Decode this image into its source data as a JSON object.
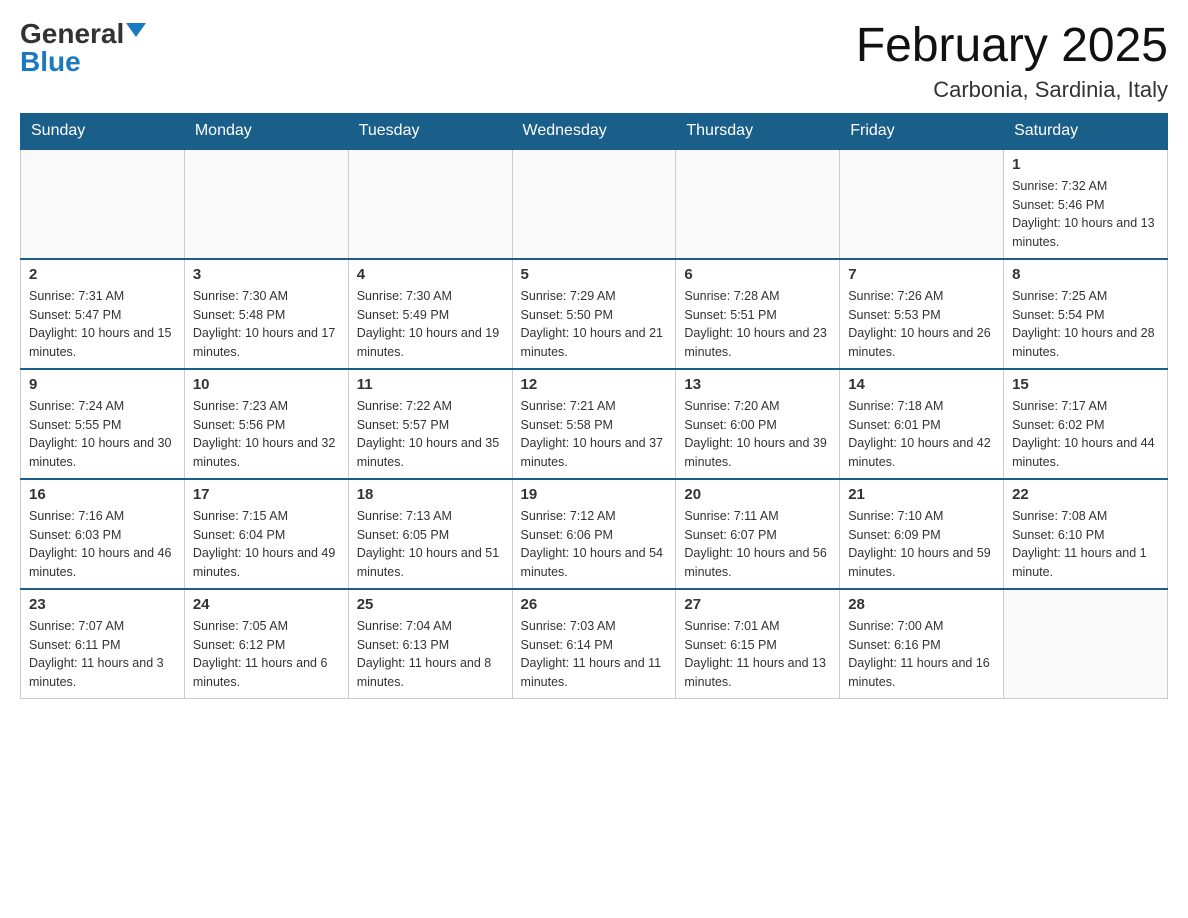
{
  "logo": {
    "general": "General",
    "blue": "Blue"
  },
  "title": "February 2025",
  "subtitle": "Carbonia, Sardinia, Italy",
  "days_of_week": [
    "Sunday",
    "Monday",
    "Tuesday",
    "Wednesday",
    "Thursday",
    "Friday",
    "Saturday"
  ],
  "weeks": [
    [
      null,
      null,
      null,
      null,
      null,
      null,
      {
        "day": "1",
        "sunrise": "Sunrise: 7:32 AM",
        "sunset": "Sunset: 5:46 PM",
        "daylight": "Daylight: 10 hours and 13 minutes."
      }
    ],
    [
      {
        "day": "2",
        "sunrise": "Sunrise: 7:31 AM",
        "sunset": "Sunset: 5:47 PM",
        "daylight": "Daylight: 10 hours and 15 minutes."
      },
      {
        "day": "3",
        "sunrise": "Sunrise: 7:30 AM",
        "sunset": "Sunset: 5:48 PM",
        "daylight": "Daylight: 10 hours and 17 minutes."
      },
      {
        "day": "4",
        "sunrise": "Sunrise: 7:30 AM",
        "sunset": "Sunset: 5:49 PM",
        "daylight": "Daylight: 10 hours and 19 minutes."
      },
      {
        "day": "5",
        "sunrise": "Sunrise: 7:29 AM",
        "sunset": "Sunset: 5:50 PM",
        "daylight": "Daylight: 10 hours and 21 minutes."
      },
      {
        "day": "6",
        "sunrise": "Sunrise: 7:28 AM",
        "sunset": "Sunset: 5:51 PM",
        "daylight": "Daylight: 10 hours and 23 minutes."
      },
      {
        "day": "7",
        "sunrise": "Sunrise: 7:26 AM",
        "sunset": "Sunset: 5:53 PM",
        "daylight": "Daylight: 10 hours and 26 minutes."
      },
      {
        "day": "8",
        "sunrise": "Sunrise: 7:25 AM",
        "sunset": "Sunset: 5:54 PM",
        "daylight": "Daylight: 10 hours and 28 minutes."
      }
    ],
    [
      {
        "day": "9",
        "sunrise": "Sunrise: 7:24 AM",
        "sunset": "Sunset: 5:55 PM",
        "daylight": "Daylight: 10 hours and 30 minutes."
      },
      {
        "day": "10",
        "sunrise": "Sunrise: 7:23 AM",
        "sunset": "Sunset: 5:56 PM",
        "daylight": "Daylight: 10 hours and 32 minutes."
      },
      {
        "day": "11",
        "sunrise": "Sunrise: 7:22 AM",
        "sunset": "Sunset: 5:57 PM",
        "daylight": "Daylight: 10 hours and 35 minutes."
      },
      {
        "day": "12",
        "sunrise": "Sunrise: 7:21 AM",
        "sunset": "Sunset: 5:58 PM",
        "daylight": "Daylight: 10 hours and 37 minutes."
      },
      {
        "day": "13",
        "sunrise": "Sunrise: 7:20 AM",
        "sunset": "Sunset: 6:00 PM",
        "daylight": "Daylight: 10 hours and 39 minutes."
      },
      {
        "day": "14",
        "sunrise": "Sunrise: 7:18 AM",
        "sunset": "Sunset: 6:01 PM",
        "daylight": "Daylight: 10 hours and 42 minutes."
      },
      {
        "day": "15",
        "sunrise": "Sunrise: 7:17 AM",
        "sunset": "Sunset: 6:02 PM",
        "daylight": "Daylight: 10 hours and 44 minutes."
      }
    ],
    [
      {
        "day": "16",
        "sunrise": "Sunrise: 7:16 AM",
        "sunset": "Sunset: 6:03 PM",
        "daylight": "Daylight: 10 hours and 46 minutes."
      },
      {
        "day": "17",
        "sunrise": "Sunrise: 7:15 AM",
        "sunset": "Sunset: 6:04 PM",
        "daylight": "Daylight: 10 hours and 49 minutes."
      },
      {
        "day": "18",
        "sunrise": "Sunrise: 7:13 AM",
        "sunset": "Sunset: 6:05 PM",
        "daylight": "Daylight: 10 hours and 51 minutes."
      },
      {
        "day": "19",
        "sunrise": "Sunrise: 7:12 AM",
        "sunset": "Sunset: 6:06 PM",
        "daylight": "Daylight: 10 hours and 54 minutes."
      },
      {
        "day": "20",
        "sunrise": "Sunrise: 7:11 AM",
        "sunset": "Sunset: 6:07 PM",
        "daylight": "Daylight: 10 hours and 56 minutes."
      },
      {
        "day": "21",
        "sunrise": "Sunrise: 7:10 AM",
        "sunset": "Sunset: 6:09 PM",
        "daylight": "Daylight: 10 hours and 59 minutes."
      },
      {
        "day": "22",
        "sunrise": "Sunrise: 7:08 AM",
        "sunset": "Sunset: 6:10 PM",
        "daylight": "Daylight: 11 hours and 1 minute."
      }
    ],
    [
      {
        "day": "23",
        "sunrise": "Sunrise: 7:07 AM",
        "sunset": "Sunset: 6:11 PM",
        "daylight": "Daylight: 11 hours and 3 minutes."
      },
      {
        "day": "24",
        "sunrise": "Sunrise: 7:05 AM",
        "sunset": "Sunset: 6:12 PM",
        "daylight": "Daylight: 11 hours and 6 minutes."
      },
      {
        "day": "25",
        "sunrise": "Sunrise: 7:04 AM",
        "sunset": "Sunset: 6:13 PM",
        "daylight": "Daylight: 11 hours and 8 minutes."
      },
      {
        "day": "26",
        "sunrise": "Sunrise: 7:03 AM",
        "sunset": "Sunset: 6:14 PM",
        "daylight": "Daylight: 11 hours and 11 minutes."
      },
      {
        "day": "27",
        "sunrise": "Sunrise: 7:01 AM",
        "sunset": "Sunset: 6:15 PM",
        "daylight": "Daylight: 11 hours and 13 minutes."
      },
      {
        "day": "28",
        "sunrise": "Sunrise: 7:00 AM",
        "sunset": "Sunset: 6:16 PM",
        "daylight": "Daylight: 11 hours and 16 minutes."
      },
      null
    ]
  ]
}
